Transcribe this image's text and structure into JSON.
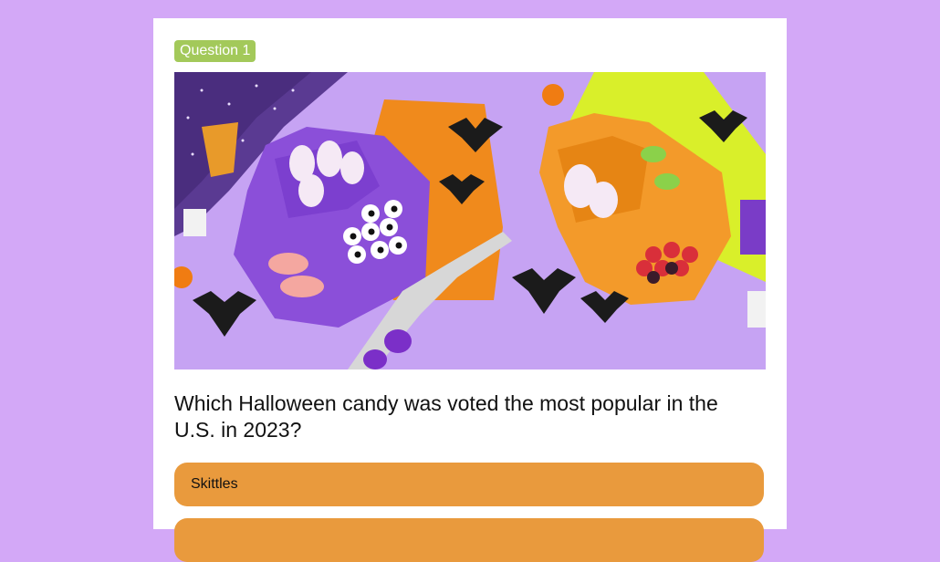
{
  "quiz": {
    "badge": "Question 1",
    "image_alt": "Halloween candy in haunted-house shaped trays surrounded by bats",
    "question": "Which Halloween candy was voted the most popular in the U.S. in 2023?",
    "answers": [
      {
        "label": "Skittles"
      },
      {
        "label": ""
      }
    ]
  },
  "colors": {
    "page_background": "#d3a8f7",
    "card_background": "#ffffff",
    "badge": "#a3c95a",
    "answer": "#e99a3d"
  }
}
